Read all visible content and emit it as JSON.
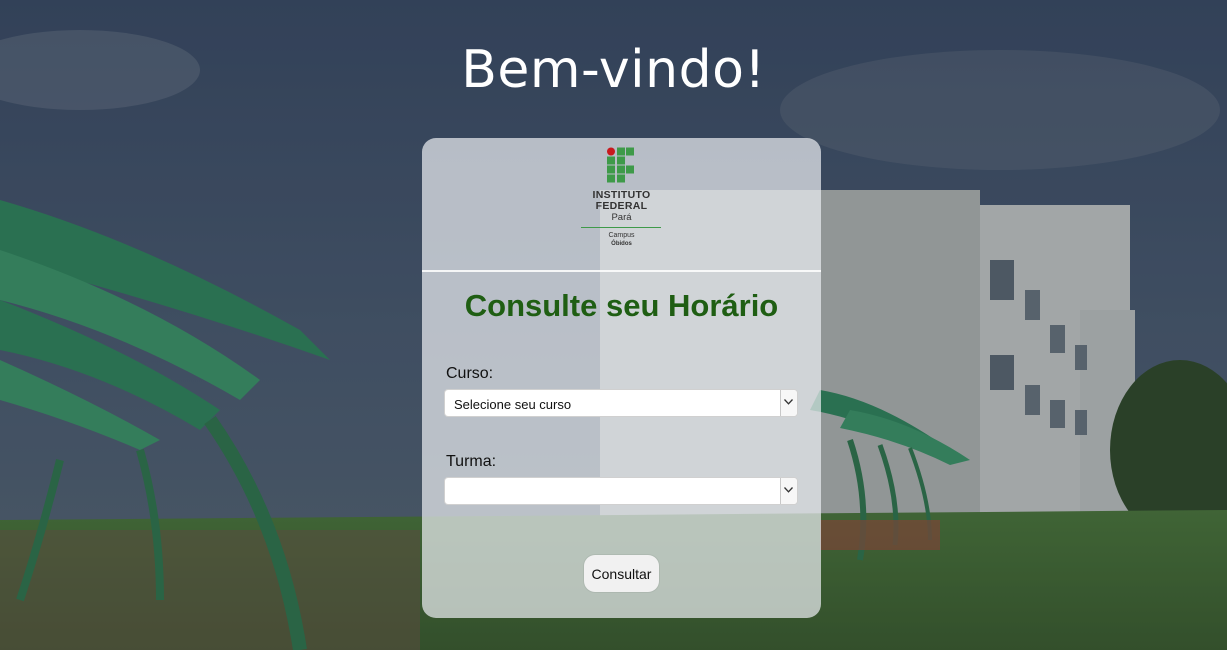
{
  "welcome": "Bem-vindo!",
  "logo": {
    "line1": "INSTITUTO",
    "line2": "FEDERAL",
    "line3": "Pará",
    "line4": "Campus",
    "line5": "Óbidos",
    "colors": {
      "green": "#3e9a49",
      "red": "#c8191e"
    }
  },
  "form": {
    "title": "Consulte seu Horário",
    "curso_label": "Curso:",
    "curso_value": "Selecione seu curso",
    "turma_label": "Turma:",
    "turma_value": "",
    "submit_label": "Consultar"
  },
  "theme": {
    "title_green": "#1f5e13"
  }
}
